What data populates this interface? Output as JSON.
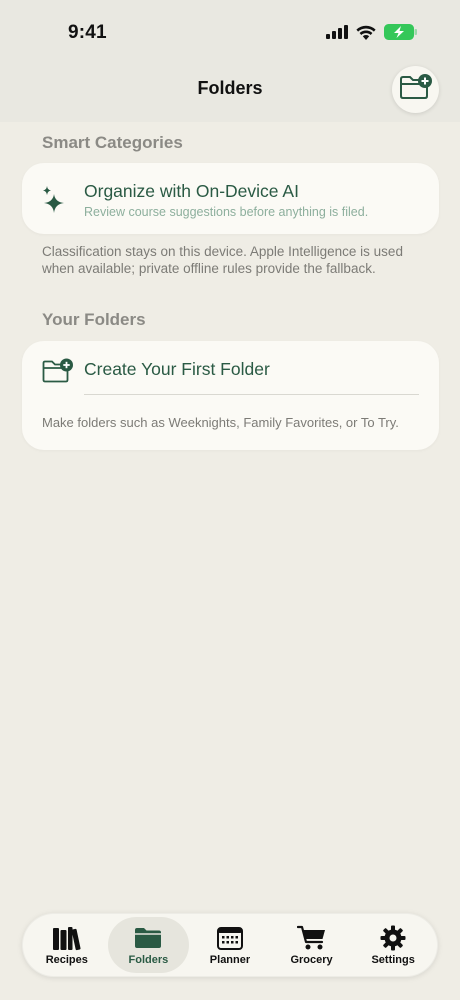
{
  "status_bar": {
    "time": "9:41",
    "icons": [
      "cellular-signal-icon",
      "wifi-icon",
      "battery-charging-icon"
    ],
    "battery_color": "#34c759"
  },
  "nav": {
    "title": "Folders",
    "action_icon": "folder-plus-icon"
  },
  "smart_categories": {
    "heading": "Smart Categories",
    "item": {
      "icon": "sparkles-icon",
      "title": "Organize with On-Device AI",
      "subtitle": "Review course suggestions before anything is filed."
    },
    "footnote": "Classification stays on this device. Apple Intelligence is used when available; private offline rules provide the fallback."
  },
  "your_folders": {
    "heading": "Your Folders",
    "item": {
      "icon": "folder-plus-icon",
      "title": "Create Your First Folder"
    },
    "hint": "Make folders such as Weeknights, Family Favorites, or To Try."
  },
  "tab_bar": {
    "tabs": [
      {
        "label": "Recipes",
        "icon": "books-icon",
        "active": false
      },
      {
        "label": "Folders",
        "icon": "folder-icon",
        "active": true
      },
      {
        "label": "Planner",
        "icon": "calendar-icon",
        "active": false
      },
      {
        "label": "Grocery",
        "icon": "cart-icon",
        "active": false
      },
      {
        "label": "Settings",
        "icon": "gear-icon",
        "active": false
      }
    ]
  },
  "colors": {
    "accent": "#2a5a44",
    "background": "#efede5",
    "card": "#fbfaf5",
    "secondary_text": "#8b8a85"
  }
}
